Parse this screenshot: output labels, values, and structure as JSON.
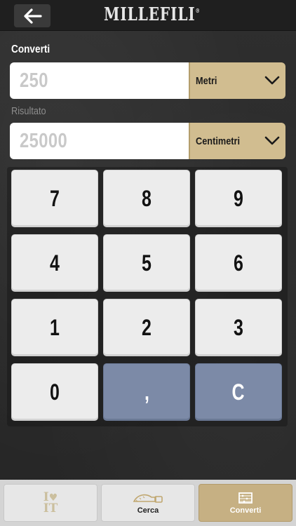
{
  "header": {
    "logo_text": "MILLEFILI",
    "logo_mark": "®",
    "back_icon": "arrow-left-icon"
  },
  "converter": {
    "input_label": "Converti",
    "input_value": "250",
    "input_unit": "Metri",
    "result_label": "Risultato",
    "result_value": "25000",
    "result_unit": "Centimetri",
    "dropdown_icon": "chevron-down-icon"
  },
  "keypad": {
    "k7": "7",
    "k8": "8",
    "k9": "9",
    "k4": "4",
    "k5": "5",
    "k6": "6",
    "k1": "1",
    "k2": "2",
    "k3": "3",
    "k0": "0",
    "comma": ",",
    "clear": "C",
    "accent_color": "#7c8aa7"
  },
  "tabs": {
    "favorites_icon": "i-love-it-icon",
    "favorites_text_top": "I",
    "favorites_text_bottom": "IT",
    "search_label": "Cerca",
    "search_icon": "tape-measure-icon",
    "convert_label": "Converti",
    "convert_icon": "abacus-icon",
    "active_color": "#c6b083"
  }
}
